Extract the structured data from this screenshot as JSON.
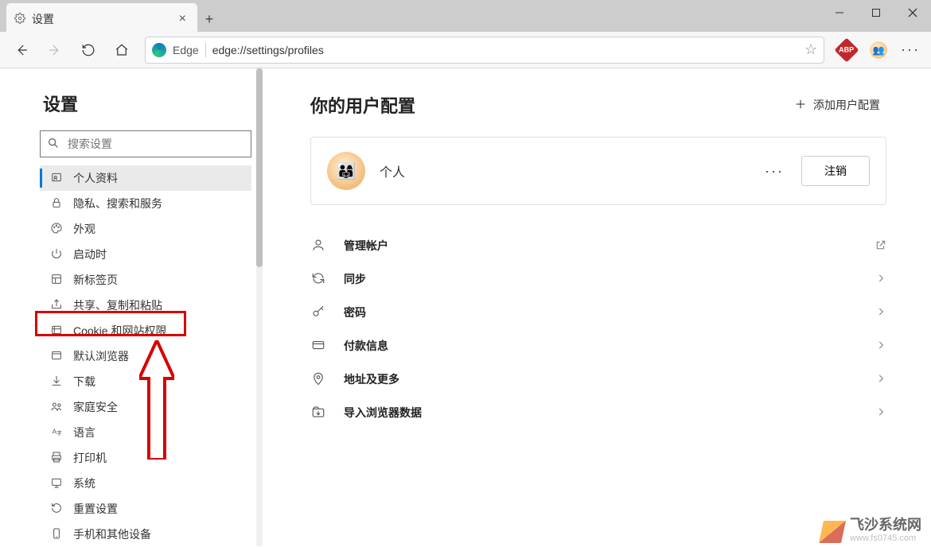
{
  "tab": {
    "title": "设置"
  },
  "toolbar": {
    "edge_label": "Edge",
    "url": "edge://settings/profiles",
    "abp_label": "ABP"
  },
  "sidebar": {
    "heading": "设置",
    "search_placeholder": "搜索设置",
    "items": [
      {
        "label": "个人资料"
      },
      {
        "label": "隐私、搜索和服务"
      },
      {
        "label": "外观"
      },
      {
        "label": "启动时"
      },
      {
        "label": "新标签页"
      },
      {
        "label": "共享、复制和粘贴"
      },
      {
        "label": "Cookie 和网站权限"
      },
      {
        "label": "默认浏览器"
      },
      {
        "label": "下载"
      },
      {
        "label": "家庭安全"
      },
      {
        "label": "语言"
      },
      {
        "label": "打印机"
      },
      {
        "label": "系统"
      },
      {
        "label": "重置设置"
      },
      {
        "label": "手机和其他设备"
      }
    ]
  },
  "main": {
    "title": "你的用户配置",
    "add_profile": "添加用户配置",
    "profile": {
      "name": "个人",
      "logout": "注销"
    },
    "rows": [
      {
        "label": "管理帐户"
      },
      {
        "label": "同步"
      },
      {
        "label": "密码"
      },
      {
        "label": "付款信息"
      },
      {
        "label": "地址及更多"
      },
      {
        "label": "导入浏览器数据"
      }
    ]
  },
  "watermark": {
    "name": "飞沙系统网",
    "url": "www.fs0745.com"
  }
}
